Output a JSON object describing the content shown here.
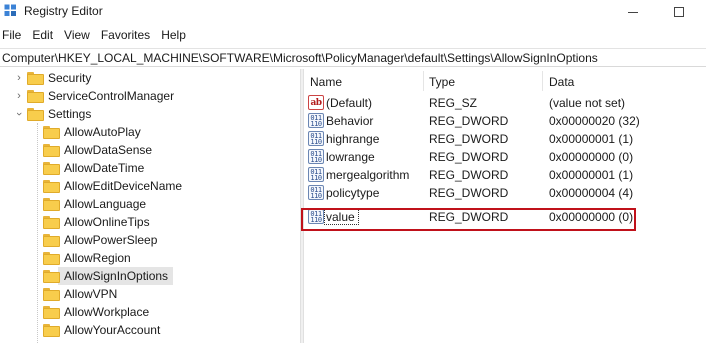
{
  "window": {
    "title": "Registry Editor",
    "app_icon": "regedit-icon",
    "controls": [
      "minimize-icon",
      "maximize-icon"
    ]
  },
  "menu": [
    "File",
    "Edit",
    "View",
    "Favorites",
    "Help"
  ],
  "address": "Computer\\HKEY_LOCAL_MACHINE\\SOFTWARE\\Microsoft\\PolicyManager\\default\\Settings\\AllowSignInOptions",
  "tree": {
    "items": [
      {
        "label": "Security",
        "expanded": false
      },
      {
        "label": "ServiceControlManager",
        "expanded": false
      },
      {
        "label": "Settings",
        "expanded": true
      },
      {
        "label": "AllowAutoPlay"
      },
      {
        "label": "AllowDataSense"
      },
      {
        "label": "AllowDateTime"
      },
      {
        "label": "AllowEditDeviceName"
      },
      {
        "label": "AllowLanguage"
      },
      {
        "label": "AllowOnlineTips"
      },
      {
        "label": "AllowPowerSleep"
      },
      {
        "label": "AllowRegion"
      },
      {
        "label": "AllowSignInOptions",
        "selected": true
      },
      {
        "label": "AllowVPN"
      },
      {
        "label": "AllowWorkplace"
      },
      {
        "label": "AllowYourAccount"
      }
    ]
  },
  "list": {
    "columns": {
      "name": "Name",
      "type": "Type",
      "data": "Data"
    },
    "rows": [
      {
        "name": "(Default)",
        "type": "REG_SZ",
        "data": "(value not set)",
        "icon": "string-value-icon",
        "icon_text": "ab"
      },
      {
        "name": "Behavior",
        "type": "REG_DWORD",
        "data": "0x00000020 (32)",
        "icon": "dword-value-icon",
        "icon_text": "011 110"
      },
      {
        "name": "highrange",
        "type": "REG_DWORD",
        "data": "0x00000001 (1)",
        "icon": "dword-value-icon",
        "icon_text": "011 110"
      },
      {
        "name": "lowrange",
        "type": "REG_DWORD",
        "data": "0x00000000 (0)",
        "icon": "dword-value-icon",
        "icon_text": "011 110"
      },
      {
        "name": "mergealgorithm",
        "type": "REG_DWORD",
        "data": "0x00000001 (1)",
        "icon": "dword-value-icon",
        "icon_text": "011 110"
      },
      {
        "name": "policytype",
        "type": "REG_DWORD",
        "data": "0x00000004 (4)",
        "icon": "dword-value-icon",
        "icon_text": "011 110"
      },
      {
        "name": "value",
        "type": "REG_DWORD",
        "data": "0x00000000 (0)",
        "icon": "dword-value-icon",
        "icon_text": "011 110",
        "highlighted": true
      }
    ]
  },
  "colors": {
    "highlight_border": "#c0111a",
    "folder": "#f8cd4c",
    "selected_bg": "#e5e5e5"
  }
}
